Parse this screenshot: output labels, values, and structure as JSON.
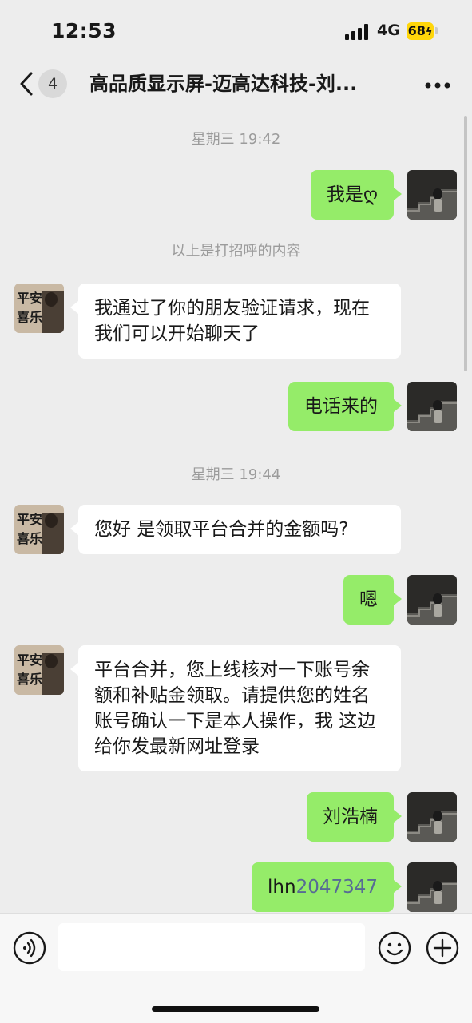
{
  "status": {
    "time": "12:53",
    "network": "4G",
    "battery": "68"
  },
  "nav": {
    "unread_count": "4",
    "title": "高品质显示屏-迈高达科技-刘..."
  },
  "messages": {
    "ts1": "星期三 19:42",
    "m1": "我是ღ",
    "note": "以上是打招呼的内容",
    "m2": "我通过了你的朋友验证请求，现在我们可以开始聊天了",
    "m3": "电话来的",
    "ts2": "星期三 19:44",
    "m4": "您好 是领取平台合并的金额吗?",
    "m5": "嗯",
    "m6": "平台合并，您上线核对一下账号余额和补贴金领取。请提供您的姓名账号确认一下是本人操作，我 这边给你发最新网址登录",
    "m7": "刘浩楠",
    "m8_prefix": "lhn",
    "m8_digits": "2047347"
  },
  "input": {
    "placeholder": ""
  },
  "icons": {
    "back": "chevron-left-icon",
    "more": "more-dots-icon",
    "voice": "voice-icon",
    "emoji": "emoji-icon",
    "plus": "plus-icon"
  },
  "colors": {
    "self_bubble": "#95ec69",
    "other_bubble": "#ffffff",
    "background": "#ededed",
    "link": "#576b95",
    "battery": "#ffd60a"
  }
}
